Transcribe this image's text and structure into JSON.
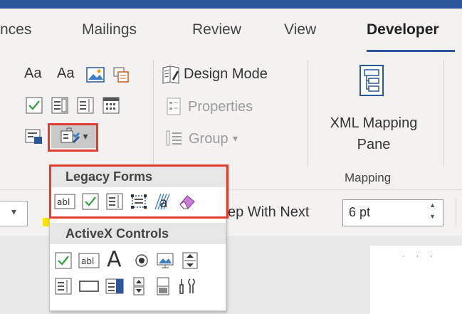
{
  "tabs": [
    {
      "label": "nces"
    },
    {
      "label": "Mailings"
    },
    {
      "label": "Review"
    },
    {
      "label": "View"
    },
    {
      "label": "Developer"
    }
  ],
  "controls_group": {
    "design_mode_label": "Design Mode",
    "properties_label": "Properties",
    "group_label": "Group",
    "group_arrow": "▾",
    "text_aa": "Aa",
    "icons": [
      "rich-text-content-control-icon",
      "plain-text-content-control-icon",
      "picture-content-control-icon",
      "building-block-gallery-icon",
      "checkbox-content-control-icon",
      "combo-box-content-control-icon",
      "dropdown-list-content-control-icon",
      "date-picker-content-control-icon",
      "repeating-section-icon",
      "legacy-tools-icon"
    ]
  },
  "mapping_group": {
    "button_label_line1": "XML Mapping",
    "button_label_line2": "Pane",
    "group_name": "Mapping"
  },
  "legacy_tools_arrow": "▾",
  "dropdown": {
    "legacy_header": "Legacy Forms",
    "legacy_items": [
      "text-form-field-icon",
      "checkbox-form-field-icon",
      "dropdown-form-field-icon",
      "insert-frame-icon",
      "form-field-shading-icon",
      "reset-form-fields-icon"
    ],
    "activex_header": "ActiveX Controls",
    "activex_row1": [
      "checkbox-control-icon",
      "textbox-control-icon",
      "label-control-icon",
      "option-button-icon",
      "image-control-icon",
      "scrollbar-control-icon"
    ],
    "activex_row2": [
      "listbox-control-icon",
      "toggle-button-icon",
      "combobox-control-icon",
      "spin-button-icon",
      "command-button-icon",
      "more-controls-icon"
    ],
    "text_field_glyph": "abl",
    "label_glyph": "A",
    "shading_glyph": "a"
  },
  "paragraph_row": {
    "keep_with_next_label": "ep With Next",
    "spacing_value": "6 pt",
    "spin_up": "▲",
    "spin_down": "▼",
    "combo_arrow": "▾"
  },
  "ruler_text": "· · ·",
  "colors": {
    "accent": "#2b579a",
    "highlight": "#e03c31",
    "check_green": "#2e9c3f"
  }
}
